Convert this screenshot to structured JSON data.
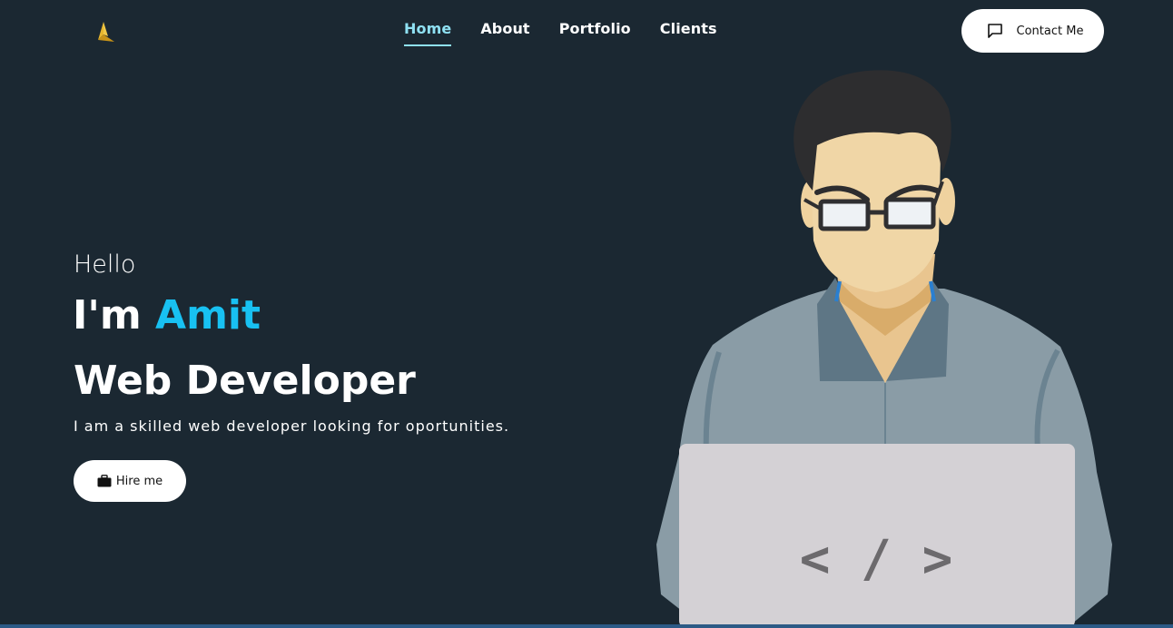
{
  "nav": {
    "items": [
      {
        "label": "Home",
        "active": true
      },
      {
        "label": "About",
        "active": false
      },
      {
        "label": "Portfolio",
        "active": false
      },
      {
        "label": "Clients",
        "active": false
      }
    ],
    "contact_label": "Contact Me",
    "contact_icon": "message-square-icon",
    "logo_icon": "logo-arrow-icon"
  },
  "hero": {
    "greeting": "Hello",
    "intro_prefix": "I'm",
    "name": "Amit",
    "role": "Web Developer",
    "tagline": "I am a skilled web developer looking for oportunities.",
    "hire_label": "Hire me",
    "hire_icon": "briefcase-icon",
    "laptop_code": "< / >"
  },
  "colors": {
    "background": "#1b2832",
    "accent": "#18c1f2",
    "nav_active": "#8fe1f3",
    "logo": "#e1b12c"
  }
}
